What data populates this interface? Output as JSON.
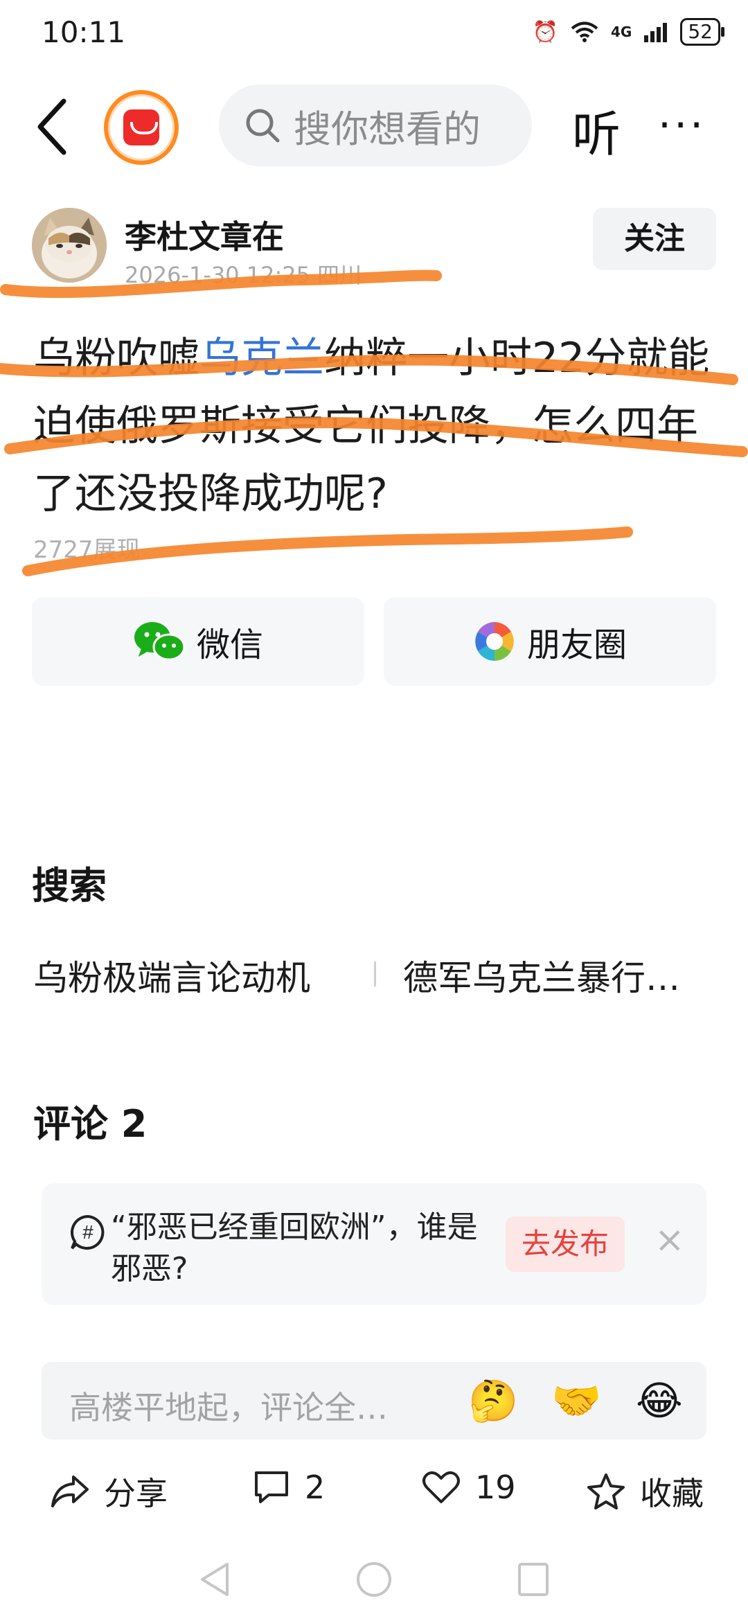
{
  "status_bar": {
    "time": "10:11",
    "network": "4G",
    "battery": "52"
  },
  "top_bar": {
    "search_placeholder": "搜你想看的",
    "listen_label": "听",
    "more_label": "···"
  },
  "author": {
    "name": "李杜文章在",
    "meta": "2026-1-30 12:25 四川",
    "follow_label": "关注"
  },
  "post": {
    "text_before": "乌粉吹嘘",
    "link_text": "乌克兰",
    "text_after": "纳粹一小时22分就能迫使俄罗斯接受它们投降，怎么四年了还没投降成功呢?",
    "views": "2727展现"
  },
  "share": {
    "wechat_label": "微信",
    "moments_label": "朋友圈"
  },
  "search_section": {
    "title": "搜索",
    "items": [
      "乌粉极端言论动机",
      "德军乌克兰暴行…"
    ]
  },
  "comments": {
    "title": "评论 2",
    "prompt_text": "“邪恶已经重回欧洲”，谁是邪恶?",
    "publish_label": "去发布",
    "close_label": "×",
    "input_placeholder": "高楼平地起，评论全…",
    "emojis": [
      "🤔",
      "🤝",
      "😂"
    ]
  },
  "actions": {
    "share_label": "分享",
    "comment_count": "2",
    "like_count": "19",
    "favorite_label": "收藏"
  },
  "colors": {
    "link": "#3374d8",
    "marker": "#f5852d",
    "publish_bg": "#fde6e6",
    "publish_text": "#e5423d"
  }
}
